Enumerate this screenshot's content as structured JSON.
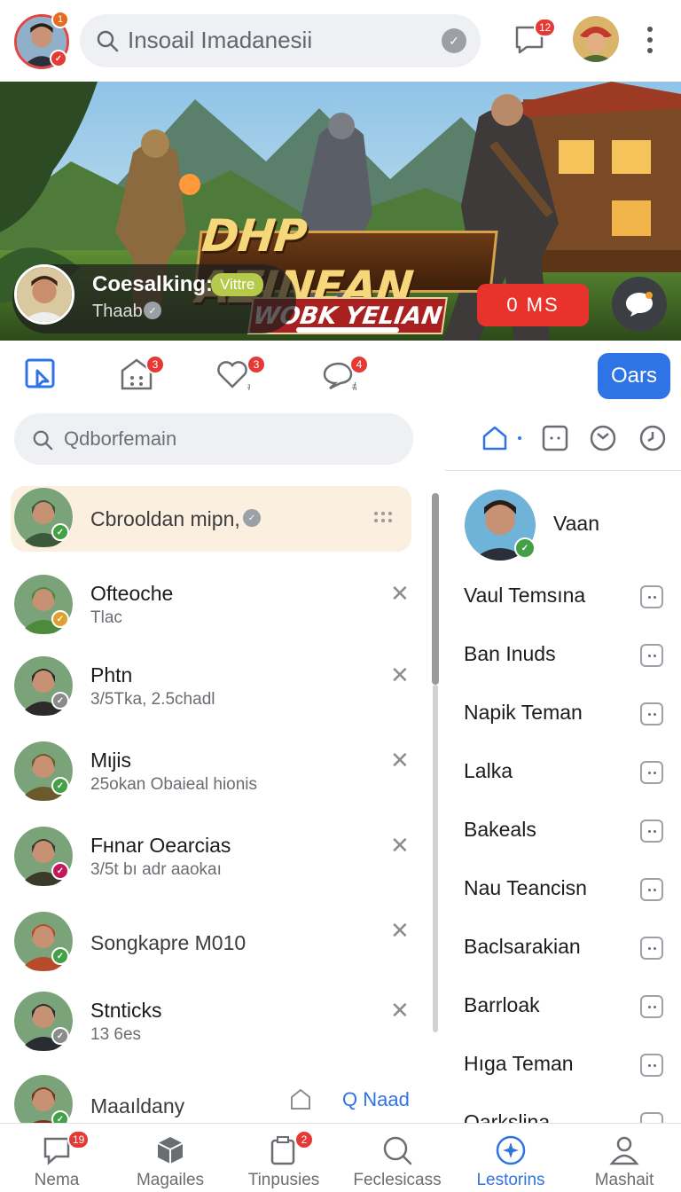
{
  "top": {
    "avatar_badge": "1",
    "search_text": "Insoail Imadanesii",
    "messages_badge": "12"
  },
  "banner": {
    "title": "DHP AZINEAN",
    "subtitle": "WOBK YELIAN",
    "streamer_name": "Coesalking:",
    "streamer_tag": "Vittre",
    "streamer_sub": "Thaab",
    "live_button": "0 MS"
  },
  "tabs": {
    "badges": [
      "3",
      "3",
      "4"
    ],
    "action_button": "Oars"
  },
  "left_search": {
    "placeholder": "Qdborfemain"
  },
  "chats": [
    {
      "name": "Cbrooldan mipn,",
      "sub": "",
      "avatar_color": "#3c5a3a",
      "status": "#43a047"
    },
    {
      "name": "Ofteoche",
      "sub": "Tlac",
      "avatar_color": "#4c8a3e",
      "status": "#e0a030"
    },
    {
      "name": "Phtn",
      "sub": "3/5Tka, 2.5chadl",
      "avatar_color": "#2e2a2a",
      "status": "#8a8a8a"
    },
    {
      "name": "Mιjis",
      "sub": "25okan Obaieal hionis",
      "avatar_color": "#6b5a2e",
      "status": "#43a047"
    },
    {
      "name": "Fʜnar Oearcias",
      "sub": "3/5t bı adr aaokaı",
      "avatar_color": "#3b3a2a",
      "status": "#c2185b"
    },
    {
      "name": "Songkapre M010",
      "sub": "",
      "avatar_color": "#b84a2c",
      "status": "#43a047"
    },
    {
      "name": "Stnticks",
      "sub": "13 6es",
      "avatar_color": "#2a2c34",
      "status": "#8a8a8a"
    },
    {
      "name": "Maaıldany",
      "sub": "",
      "avatar_color": "#7a3320",
      "status": "#43a047"
    }
  ],
  "chat_action_link": "Q Naad",
  "friends": {
    "header_name": "Vaan",
    "items": [
      "Vaul Temsına",
      "Ban Inuds",
      "Napik Teman",
      "Lalka",
      "Bakeals",
      "Nau Teancisn",
      "Baclsarakian",
      "Barrloak",
      "Hıga Teman",
      "Oarkslina"
    ]
  },
  "bottom_nav": {
    "items": [
      {
        "label": "Nema",
        "badge": "19"
      },
      {
        "label": "Magailes",
        "badge": ""
      },
      {
        "label": "Tinpusies",
        "badge": "2"
      },
      {
        "label": "Feclesicass",
        "badge": ""
      },
      {
        "label": "Lestorins",
        "badge": ""
      },
      {
        "label": "Mashait",
        "badge": ""
      }
    ],
    "active_index": 4
  },
  "colors": {
    "accent": "#2f74e6",
    "badge": "#e53935",
    "highlight_row": "#fbf0df"
  }
}
